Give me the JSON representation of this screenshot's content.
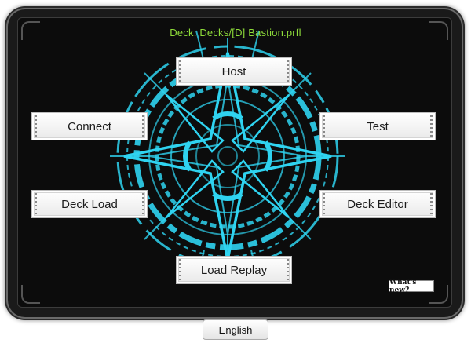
{
  "deck": {
    "label": "Deck: Decks/[D] Bastion.prfl"
  },
  "menu": {
    "host": "Host",
    "connect": "Connect",
    "test": "Test",
    "deck_load": "Deck Load",
    "deck_editor": "Deck Editor",
    "load_replay": "Load Replay"
  },
  "whats_new": "What's new?",
  "language": "English",
  "colors": {
    "emblem": "#2fd3f0",
    "deck_label": "#8edc3a",
    "background": "#0c0c0c"
  }
}
